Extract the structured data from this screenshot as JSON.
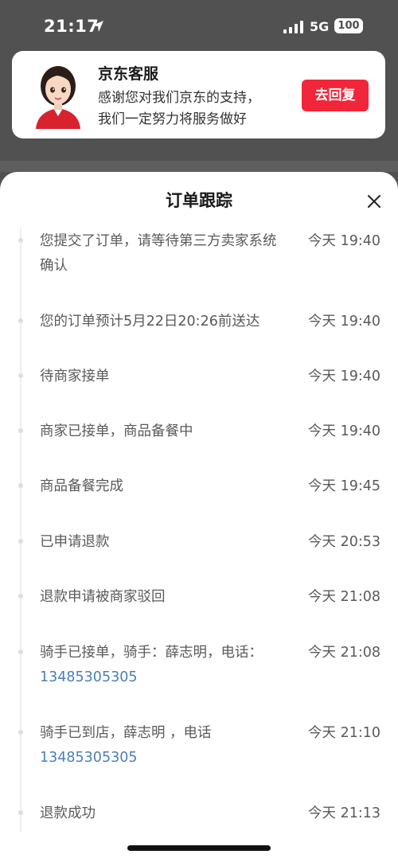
{
  "status_bar": {
    "time": "21:17",
    "network": "5G",
    "battery": "100"
  },
  "notification": {
    "title": "京东客服",
    "line1": "感谢您对我们京东的支持，",
    "line2": "我们一定努力将服务做好",
    "reply_label": "去回复"
  },
  "sheet": {
    "title": "订单跟踪",
    "events": [
      {
        "text": "您提交了订单，请等待第三方卖家系统确认",
        "time": "今天 19:40"
      },
      {
        "text": "您的订单预计5月22日20:26前送达",
        "time": "今天 19:40"
      },
      {
        "text": "待商家接单",
        "time": "今天 19:40"
      },
      {
        "text": "商家已接单，商品备餐中",
        "time": "今天 19:40"
      },
      {
        "text": "商品备餐完成",
        "time": "今天 19:45"
      },
      {
        "text": "已申请退款",
        "time": "今天 20:53"
      },
      {
        "text": "退款申请被商家驳回",
        "time": "今天 21:08"
      },
      {
        "text": "骑手已接单，骑手：薛志明，电话：",
        "phone": "13485305305",
        "time": "今天 21:08"
      },
      {
        "text": "骑手已到店，薛志明 ，电话",
        "phone": "13485305305",
        "time": "今天 21:10"
      },
      {
        "text": "退款成功",
        "time": "今天 21:13"
      }
    ]
  },
  "icons": {
    "location": "location-arrow-icon",
    "signal": "cellular-signal-icon",
    "close": "close-icon"
  },
  "colors": {
    "reply_button": "#f2263a",
    "phone_link": "#4a7fb5"
  }
}
